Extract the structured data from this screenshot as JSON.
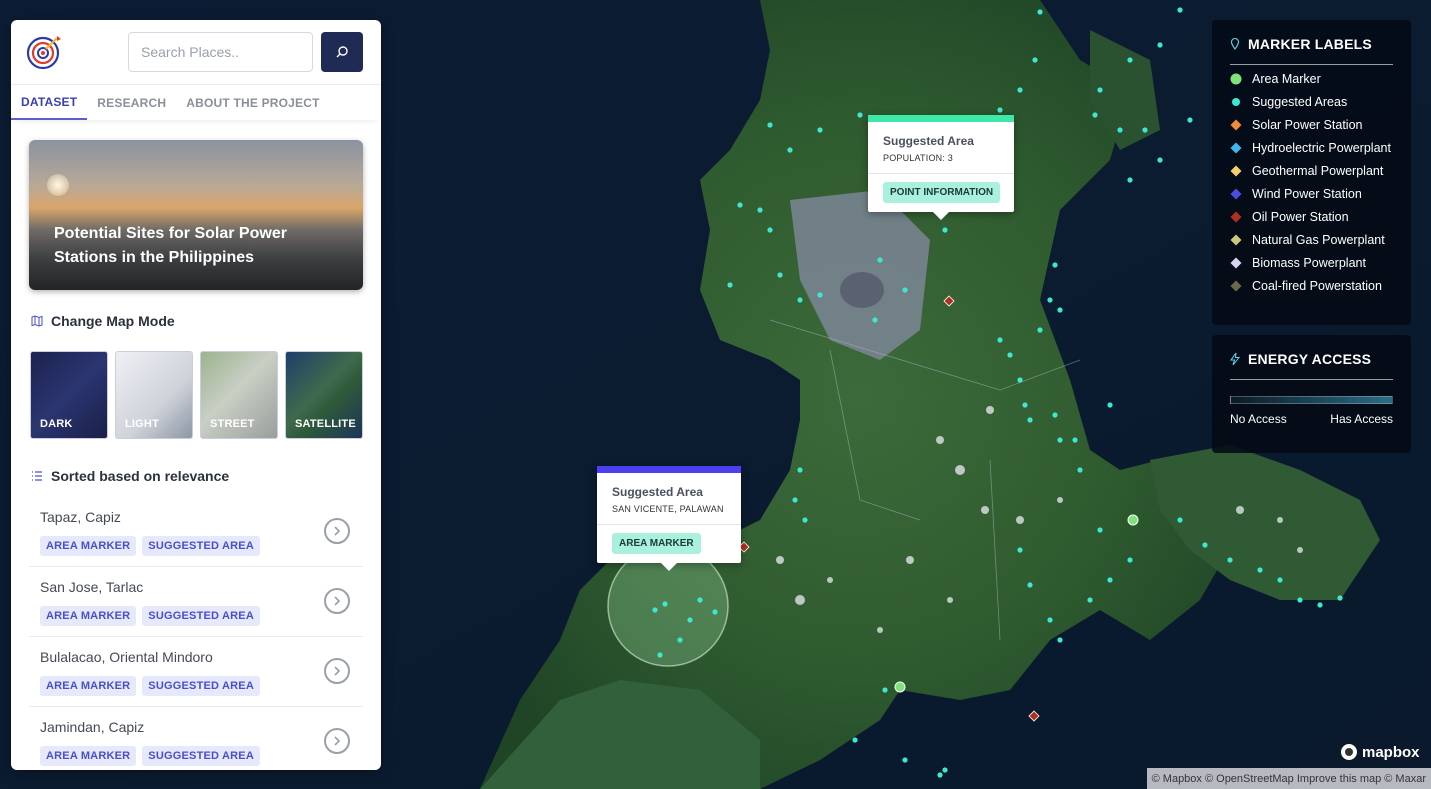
{
  "search": {
    "placeholder": "Search Places.."
  },
  "tabs": [
    {
      "label": "DATASET",
      "active": true
    },
    {
      "label": "RESEARCH",
      "active": false
    },
    {
      "label": "ABOUT THE PROJECT",
      "active": false
    }
  ],
  "hero": {
    "title": "Potential Sites for Solar Power Stations in the Philippines"
  },
  "map_mode": {
    "heading": "Change Map Mode",
    "modes": [
      "DARK",
      "LIGHT",
      "STREET",
      "SATELLITE"
    ]
  },
  "list": {
    "heading": "Sorted based on relevance",
    "items": [
      {
        "place": "Tapaz, Capiz",
        "badges": [
          "AREA MARKER",
          "SUGGESTED AREA"
        ]
      },
      {
        "place": "San Jose, Tarlac",
        "badges": [
          "AREA MARKER",
          "SUGGESTED AREA"
        ]
      },
      {
        "place": "Bulalacao, Oriental Mindoro",
        "badges": [
          "AREA MARKER",
          "SUGGESTED AREA"
        ]
      },
      {
        "place": "Jamindan, Capiz",
        "badges": [
          "AREA MARKER",
          "SUGGESTED AREA"
        ]
      }
    ]
  },
  "popup_point": {
    "title": "Suggested Area",
    "subtitle": "POPULATION: 3",
    "button": "POINT INFORMATION",
    "accent": "#3ee8a8"
  },
  "popup_area": {
    "title": "Suggested Area",
    "subtitle": "SAN VICENTE, PALAWAN",
    "button": "AREA MARKER",
    "accent": "#4b3ff0"
  },
  "marker_labels": {
    "title": "MARKER LABELS",
    "items": [
      {
        "label": "Area Marker",
        "shape": "circle",
        "color": "#7ee37a"
      },
      {
        "label": "Suggested Areas",
        "shape": "dot",
        "color": "#3ee8d0"
      },
      {
        "label": "Solar Power Station",
        "shape": "diamond",
        "color": "#f08a3c"
      },
      {
        "label": "Hydroelectric Powerplant",
        "shape": "diamond",
        "color": "#3cb8f0"
      },
      {
        "label": "Geothermal Powerplant",
        "shape": "diamond",
        "color": "#f5cf6a"
      },
      {
        "label": "Wind Power Station",
        "shape": "diamond",
        "color": "#4a4ee0"
      },
      {
        "label": "Oil Power Station",
        "shape": "diamond",
        "color": "#b03020"
      },
      {
        "label": "Natural Gas Powerplant",
        "shape": "diamond",
        "color": "#c9c97a"
      },
      {
        "label": "Biomass Powerplant",
        "shape": "diamond",
        "color": "#d8d4f0"
      },
      {
        "label": "Coal-fired Powerstation",
        "shape": "diamond",
        "color": "#6a6a4a"
      }
    ]
  },
  "energy_access": {
    "title": "ENERGY ACCESS",
    "low_label": "No Access",
    "high_label": "Has Access"
  },
  "mapbox": {
    "logo": "mapbox",
    "attribution": "© Mapbox © OpenStreetMap Improve this map © Maxar"
  }
}
